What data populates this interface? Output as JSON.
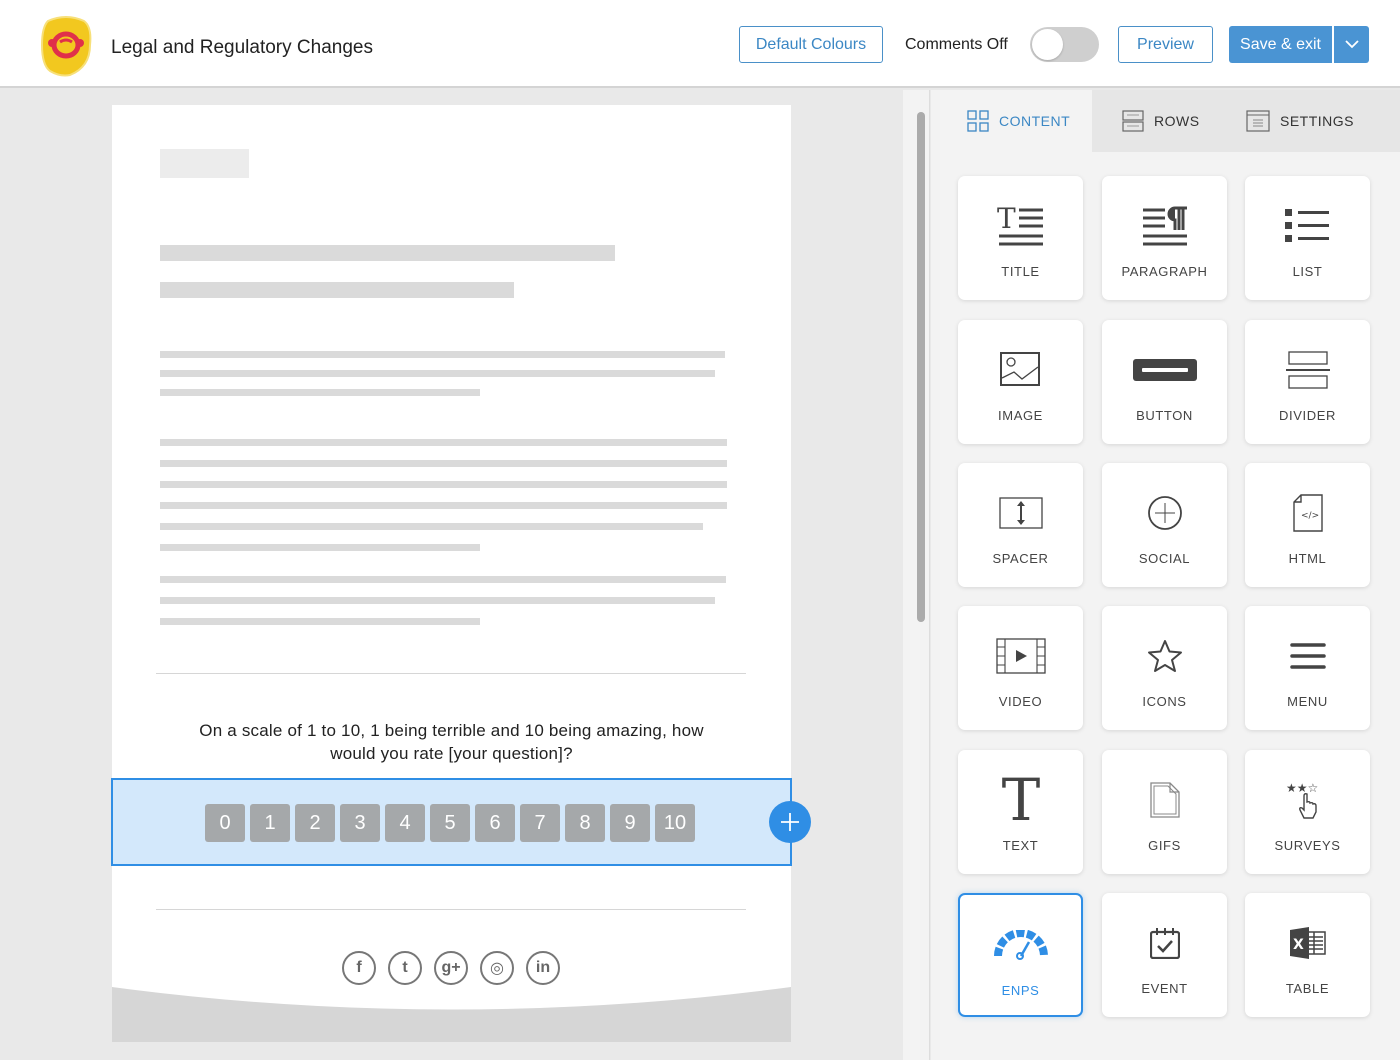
{
  "header": {
    "title": "Legal and Regulatory Changes",
    "default_colours_label": "Default Colours",
    "comments_label": "Comments Off",
    "comments_enabled": false,
    "preview_label": "Preview",
    "save_label": "Save & exit"
  },
  "canvas": {
    "question": "On a scale of 1 to 10, 1 being terrible and 10 being amazing, how would you rate [your question]?",
    "scale": [
      "0",
      "1",
      "2",
      "3",
      "4",
      "5",
      "6",
      "7",
      "8",
      "9",
      "10"
    ],
    "social_icons": [
      "facebook-icon",
      "twitter-icon",
      "google-plus-icon",
      "instagram-icon",
      "linkedin-icon"
    ],
    "social_glyphs": [
      "f",
      "t",
      "g+",
      "◎",
      "in"
    ]
  },
  "panel": {
    "tabs": [
      {
        "label": "CONTENT",
        "active": true
      },
      {
        "label": "ROWS",
        "active": false
      },
      {
        "label": "SETTINGS",
        "active": false
      }
    ],
    "tiles": [
      {
        "label": "TITLE",
        "icon": "title-icon"
      },
      {
        "label": "PARAGRAPH",
        "icon": "paragraph-icon"
      },
      {
        "label": "LIST",
        "icon": "list-icon"
      },
      {
        "label": "IMAGE",
        "icon": "image-icon"
      },
      {
        "label": "BUTTON",
        "icon": "button-icon"
      },
      {
        "label": "DIVIDER",
        "icon": "divider-icon"
      },
      {
        "label": "SPACER",
        "icon": "spacer-icon"
      },
      {
        "label": "SOCIAL",
        "icon": "social-icon"
      },
      {
        "label": "HTML",
        "icon": "html-icon"
      },
      {
        "label": "VIDEO",
        "icon": "video-icon"
      },
      {
        "label": "ICONS",
        "icon": "star-icon"
      },
      {
        "label": "MENU",
        "icon": "menu-icon"
      },
      {
        "label": "TEXT",
        "icon": "text-icon"
      },
      {
        "label": "GIFS",
        "icon": "gif-icon"
      },
      {
        "label": "SURVEYS",
        "icon": "survey-icon"
      },
      {
        "label": "ENPS",
        "icon": "gauge-icon",
        "selected": true
      },
      {
        "label": "EVENT",
        "icon": "calendar-check-icon"
      },
      {
        "label": "TABLE",
        "icon": "excel-table-icon"
      }
    ]
  },
  "colors": {
    "accent": "#2f8ee5",
    "primary_button": "#4a94d3",
    "scale_button": "#a5a8aa",
    "selection_bg": "#d3e8fb"
  }
}
